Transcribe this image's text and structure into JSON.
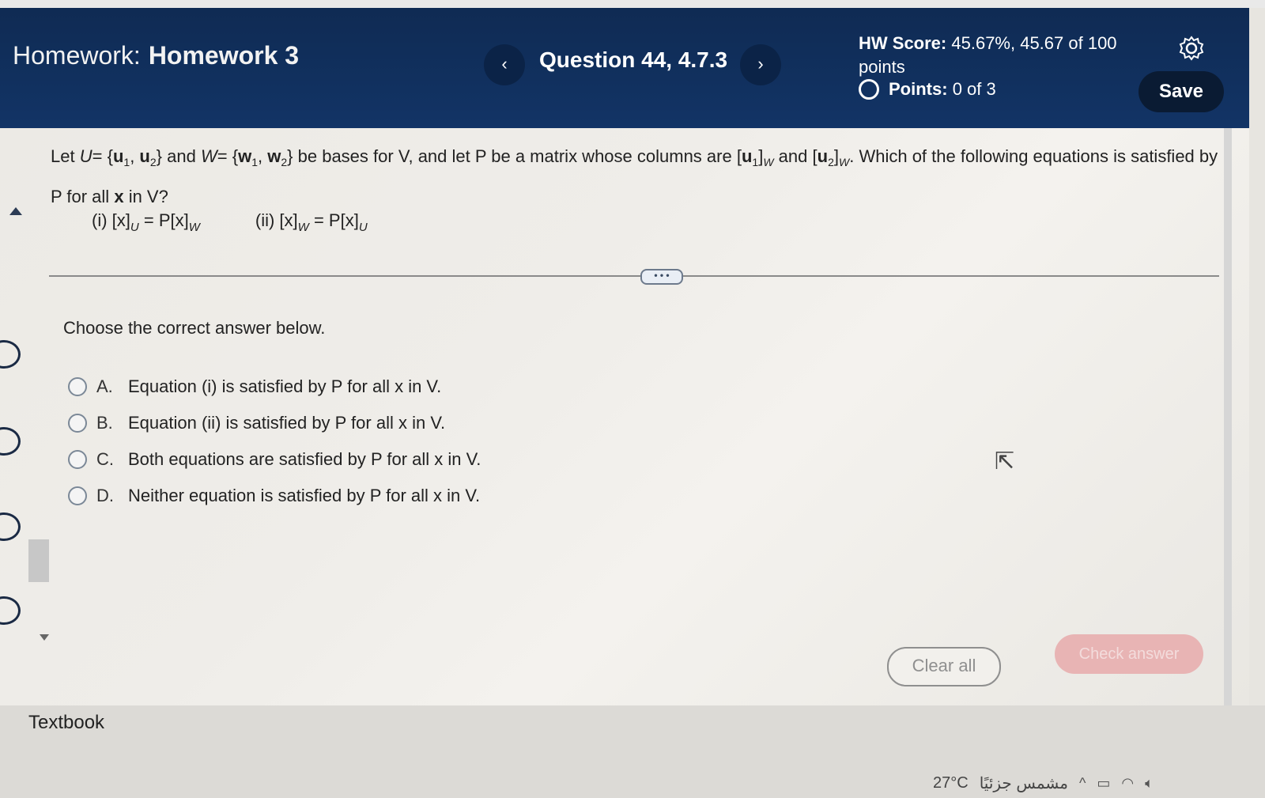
{
  "header": {
    "homework_prefix": "Homework:",
    "homework_name": "Homework 3",
    "prev_label": "‹",
    "next_label": "›",
    "question_label": "Question 44, 4.7.3",
    "score_label": "HW Score:",
    "score_value": "45.67%, 45.67 of 100 points",
    "points_label": "Points:",
    "points_value": "0 of 3",
    "save_label": "Save"
  },
  "question": {
    "let": "Let",
    "U": "U",
    "eq": "=",
    "u1": "u",
    "u2": "u",
    "and1": "and",
    "W": "W",
    "w1": "w",
    "w2": "w",
    "sub1": "1",
    "sub2": "2",
    "body_text": "be bases for V, and let P be a matrix whose columns are",
    "and2": "and",
    "tail_text": "Which of the following equations is satisfied by P for all",
    "x": "x",
    "in_v": "in V?"
  },
  "equations": {
    "eq1_prefix": "(i) [x]",
    "eq1_sub": "U",
    "eq1_mid": "= P[x]",
    "eq1_sub2": "W",
    "eq2_prefix": "(ii) [x]",
    "eq2_sub": "W",
    "eq2_mid": "= P[x]",
    "eq2_sub2": "U"
  },
  "more_label": "• • •",
  "prompt": "Choose the correct answer below.",
  "choices": [
    {
      "letter": "A.",
      "text": "Equation (i) is satisfied by P for all x in V."
    },
    {
      "letter": "B.",
      "text": "Equation (ii) is satisfied by P for all x in V."
    },
    {
      "letter": "C.",
      "text": "Both equations are satisfied by P for all x in V."
    },
    {
      "letter": "D.",
      "text": "Neither equation is satisfied by P for all x in V."
    }
  ],
  "buttons": {
    "clear_all": "Clear all",
    "check_answer": "Check answer"
  },
  "footer": {
    "textbook": "Textbook"
  },
  "taskbar": {
    "temperature": "27°C",
    "weather_text": "مشمس جزئيًا"
  },
  "colors": {
    "header_bg": "#123466",
    "save_bg": "#0a1b33",
    "check_bg": "#e8b4b4"
  }
}
